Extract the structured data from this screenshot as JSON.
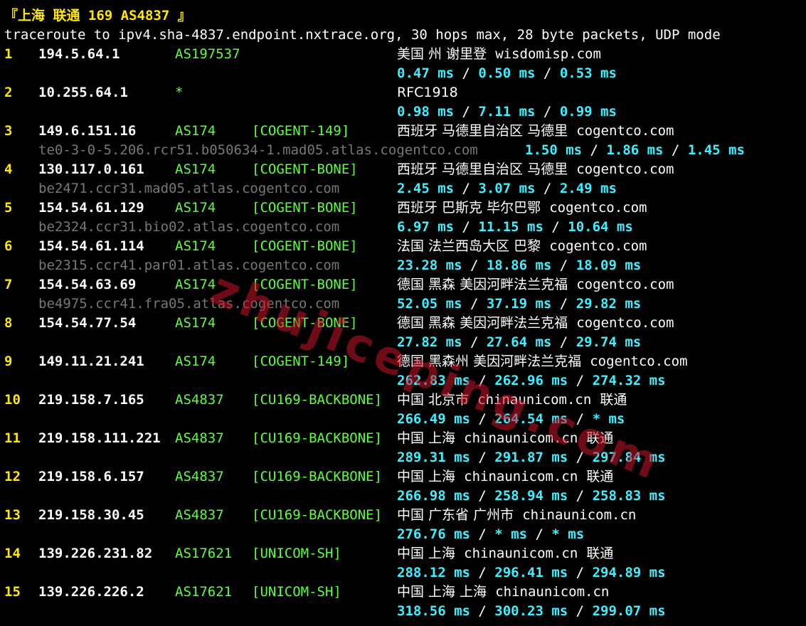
{
  "title": "『上海 联通 169 AS4837 』",
  "header": "traceroute to ipv4.sha-4837.endpoint.nxtrace.org, 30 hops max, 28 byte packets, UDP mode",
  "watermark": "zhujiceping.com",
  "colors": {
    "background": "#000000",
    "hop_number": "#ffe800",
    "asn": "#5cff3b",
    "rtt": "#3ef0ff",
    "rdns": "#777777",
    "watermark": "#c81428"
  },
  "hops": [
    {
      "n": "1",
      "ip": "194.5.64.1",
      "asn": "AS197537",
      "net": "",
      "geo": "美国 州 谢里登",
      "dom": "wisdomisp.com",
      "isp": "",
      "rdns": "",
      "rtt": [
        "0.47 ms",
        "0.50 ms",
        "0.53 ms"
      ]
    },
    {
      "n": "2",
      "ip": "10.255.64.1",
      "asn": "*",
      "net": "",
      "geo": "RFC1918",
      "dom": "",
      "isp": "",
      "rdns": "",
      "rtt": [
        "0.98 ms",
        "7.11 ms",
        "0.99 ms"
      ]
    },
    {
      "n": "3",
      "ip": "149.6.151.16",
      "asn": "AS174",
      "net": "[COGENT-149]",
      "geo": "西班牙 马德里自治区 马德里",
      "dom": "cogentco.com",
      "isp": "",
      "rdns": "te0-3-0-5.206.rcr51.b050634-1.mad05.atlas.cogentco.com",
      "rtt": [
        "1.50 ms",
        "1.86 ms",
        "1.45 ms"
      ]
    },
    {
      "n": "4",
      "ip": "130.117.0.161",
      "asn": "AS174",
      "net": "[COGENT-BONE]",
      "geo": "西班牙 马德里自治区 马德里",
      "dom": "cogentco.com",
      "isp": "",
      "rdns": "be2471.ccr31.mad05.atlas.cogentco.com",
      "rtt": [
        "2.45 ms",
        "3.07 ms",
        "2.49 ms"
      ]
    },
    {
      "n": "5",
      "ip": "154.54.61.129",
      "asn": "AS174",
      "net": "[COGENT-BONE]",
      "geo": "西班牙 巴斯克 毕尔巴鄂",
      "dom": "cogentco.com",
      "isp": "",
      "rdns": "be2324.ccr31.bio02.atlas.cogentco.com",
      "rtt": [
        "6.97 ms",
        "11.15 ms",
        "10.64 ms"
      ]
    },
    {
      "n": "6",
      "ip": "154.54.61.114",
      "asn": "AS174",
      "net": "[COGENT-BONE]",
      "geo": "法国 法兰西岛大区 巴黎",
      "dom": "cogentco.com",
      "isp": "",
      "rdns": "be2315.ccr41.par01.atlas.cogentco.com",
      "rtt": [
        "23.28 ms",
        "18.86 ms",
        "18.09 ms"
      ]
    },
    {
      "n": "7",
      "ip": "154.54.63.69",
      "asn": "AS174",
      "net": "[COGENT-BONE]",
      "geo": "德国 黑森 美因河畔法兰克福",
      "dom": "cogentco.com",
      "isp": "",
      "rdns": "be4975.ccr41.fra05.atlas.cogentco.com",
      "rtt": [
        "52.05 ms",
        "37.19 ms",
        "29.82 ms"
      ]
    },
    {
      "n": "8",
      "ip": "154.54.77.54",
      "asn": "AS174",
      "net": "[COGENT-BONE]",
      "geo": "德国 黑森 美因河畔法兰克福",
      "dom": "cogentco.com",
      "isp": "",
      "rdns": "",
      "rtt": [
        "27.82 ms",
        "27.64 ms",
        "29.74 ms"
      ]
    },
    {
      "n": "9",
      "ip": "149.11.21.241",
      "asn": "AS174",
      "net": "[COGENT-149]",
      "geo": "德国 黑森州 美因河畔法兰克福",
      "dom": "cogentco.com",
      "isp": "",
      "rdns": "",
      "rtt": [
        "262.83 ms",
        "262.96 ms",
        "274.32 ms"
      ]
    },
    {
      "n": "10",
      "ip": "219.158.7.165",
      "asn": "AS4837",
      "net": "[CU169-BACKBONE]",
      "geo": "中国 北京市",
      "dom": "chinaunicom.cn",
      "isp": "联通",
      "rdns": "",
      "rtt": [
        "266.49 ms",
        "264.54 ms",
        "* ms"
      ]
    },
    {
      "n": "11",
      "ip": "219.158.111.221",
      "asn": "AS4837",
      "net": "[CU169-BACKBONE]",
      "geo": "中国 上海",
      "dom": "chinaunicom.cn",
      "isp": "联通",
      "rdns": "",
      "rtt": [
        "289.31 ms",
        "291.87 ms",
        "297.84 ms"
      ]
    },
    {
      "n": "12",
      "ip": "219.158.6.157",
      "asn": "AS4837",
      "net": "[CU169-BACKBONE]",
      "geo": "中国 上海",
      "dom": "chinaunicom.cn",
      "isp": "联通",
      "rdns": "",
      "rtt": [
        "266.98 ms",
        "258.94 ms",
        "258.83 ms"
      ]
    },
    {
      "n": "13",
      "ip": "219.158.30.45",
      "asn": "AS4837",
      "net": "[CU169-BACKBONE]",
      "geo": "中国 广东省 广州市",
      "dom": "chinaunicom.cn",
      "isp": "",
      "rdns": "",
      "rtt": [
        "276.76 ms",
        "* ms",
        "* ms"
      ]
    },
    {
      "n": "14",
      "ip": "139.226.231.82",
      "asn": "AS17621",
      "net": "[UNICOM-SH]",
      "geo": "中国 上海",
      "dom": "chinaunicom.cn",
      "isp": "联通",
      "rdns": "",
      "rtt": [
        "288.12 ms",
        "296.41 ms",
        "294.89 ms"
      ]
    },
    {
      "n": "15",
      "ip": "139.226.226.2",
      "asn": "AS17621",
      "net": "[UNICOM-SH]",
      "geo": "中国 上海 上海",
      "dom": "chinaunicom.cn",
      "isp": "",
      "rdns": "",
      "rtt": [
        "318.56 ms",
        "300.23 ms",
        "299.07 ms"
      ]
    }
  ]
}
